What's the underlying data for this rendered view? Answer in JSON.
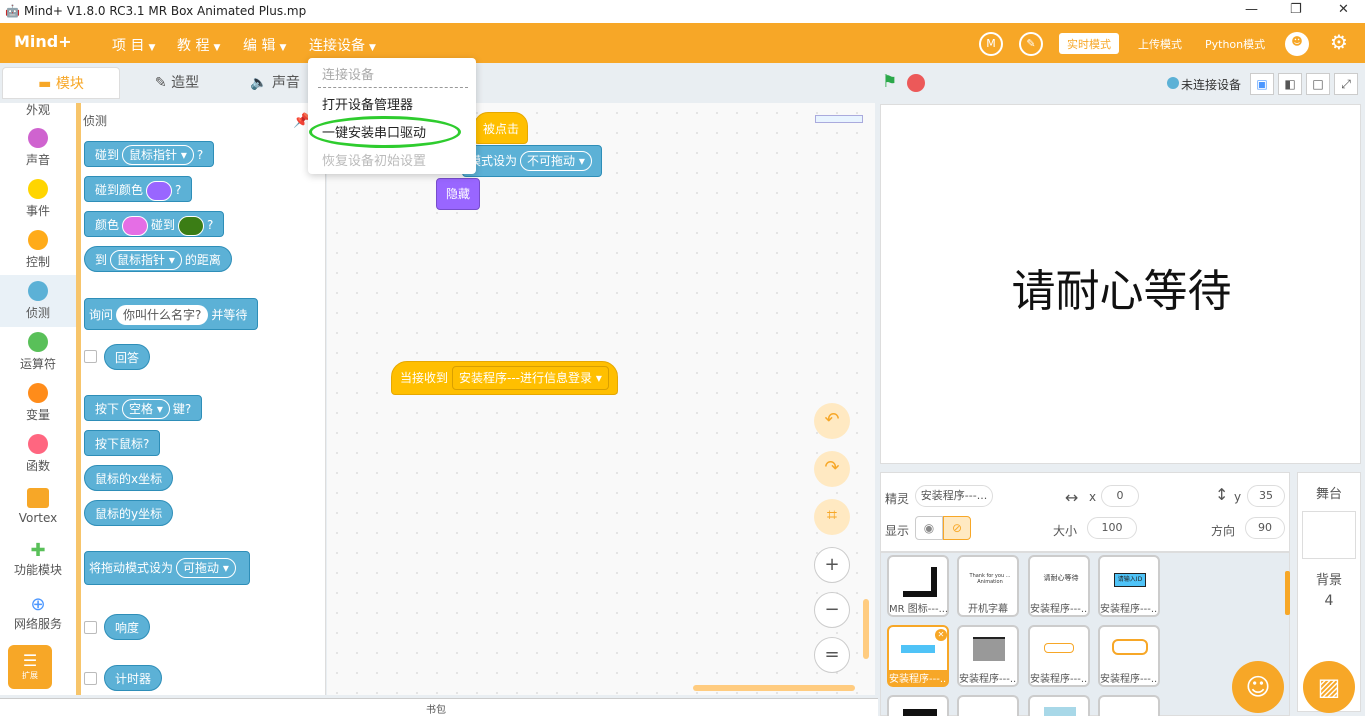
{
  "window": {
    "title": "Mind+ V1.8.0 RC3.1   MR Box Animated Plus.mp"
  },
  "menubar": {
    "logo": "Mind+",
    "project": "项 目",
    "tutorial": "教 程",
    "edit": "编 辑",
    "connect": "连接设备",
    "realtime": "实时模式",
    "upload": "上传模式",
    "python": "Python模式"
  },
  "dropdown": {
    "header": "连接设备",
    "item1": "打开设备管理器",
    "item2": "一键安装串口驱动",
    "item3": "恢复设备初始设置"
  },
  "tabs": {
    "blocks": "模块",
    "costumes": "造型",
    "sounds": "声音"
  },
  "categories": [
    {
      "label": "外观",
      "color": "#9966ff"
    },
    {
      "label": "声音",
      "color": "#cf63cf"
    },
    {
      "label": "事件",
      "color": "#ffd500"
    },
    {
      "label": "控制",
      "color": "#ffab19"
    },
    {
      "label": "侦测",
      "color": "#5cb1d6"
    },
    {
      "label": "运算符",
      "color": "#59c059"
    },
    {
      "label": "变量",
      "color": "#ff8c1a"
    },
    {
      "label": "函数",
      "color": "#ff6680"
    },
    {
      "label": "Vortex",
      "color": "#f7a727"
    },
    {
      "label": "功能模块",
      "color": "#59c059"
    },
    {
      "label": "网络服务",
      "color": "#4c97ff"
    },
    {
      "label": "扩展",
      "color": "#f7a727"
    }
  ],
  "palette": {
    "section": "侦测",
    "touching": "碰到",
    "mouse_pointer": "鼠标指针",
    "q": "?",
    "touching_color": "碰到颜色",
    "color": "颜色",
    "touch": "碰到",
    "to": "到",
    "distance": "的距离",
    "ask": "询问",
    "ask_default": "你叫什么名字?",
    "and_wait": "并等待",
    "answer": "回答",
    "press": "按下",
    "space": "空格",
    "key": "键?",
    "mouse_down": "按下鼠标?",
    "mouse_x": "鼠标的x坐标",
    "mouse_y": "鼠标的y坐标",
    "drag_mode": "将拖动模式设为",
    "draggable": "可拖动",
    "loudness": "响度",
    "timer": "计时器"
  },
  "workspace": {
    "clicked": "被点击",
    "set_drag": "模式设为",
    "not_draggable": "不可拖动",
    "hide": "隐藏",
    "when_receive": "当接收到",
    "message": "安装程序---进行信息登录"
  },
  "stage": {
    "connection": "未连接设备",
    "message": "请耐心等待"
  },
  "sprite": {
    "label": "精灵",
    "name": "安装程序---...",
    "x_label": "x",
    "x": "0",
    "y_label": "y",
    "y": "35",
    "show": "显示",
    "size_label": "大小",
    "size": "100",
    "dir_label": "方向",
    "dir": "90"
  },
  "sprites": [
    {
      "cap": "MR 图标---..."
    },
    {
      "cap": "开机字幕"
    },
    {
      "cap": "安装程序---..."
    },
    {
      "cap": "安装程序---..."
    },
    {
      "cap": "安装程序---..."
    },
    {
      "cap": "安装程序---..."
    },
    {
      "cap": "安装程序---..."
    },
    {
      "cap": "安装程序---..."
    }
  ],
  "thumbs": {
    "t2": "Thank for you ... Animation",
    "t3": "请耐心等待",
    "t4": "请输入ID"
  },
  "stage_panel": {
    "title": "舞台",
    "backdrop": "背景",
    "count": "4"
  },
  "footer": {
    "backpack": "书包"
  }
}
